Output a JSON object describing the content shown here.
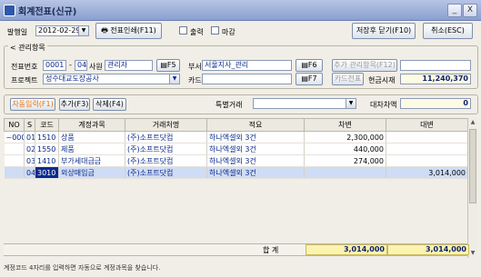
{
  "window": {
    "title": "회계전표(신규)",
    "minimize": "_",
    "close": "X"
  },
  "toolbar": {
    "date_label": "발행일",
    "date_value": "2012-02-29",
    "print_button": "전표인쇄(F11)",
    "output_label": "출력",
    "close_label": "마감",
    "save_close_button": "저장후 닫기(F10)",
    "cancel_button": "취소(ESC)"
  },
  "manage": {
    "section_title": "관리항목",
    "voucher_no_label": "전표번호",
    "voucher_no_a": "0001",
    "voucher_no_sep": "-",
    "voucher_no_b": "04",
    "employee_label": "사원",
    "employee_value": "관리자",
    "dept_label": "부서",
    "dept_value": "서울지사_관리",
    "add_item_button": "추가 관리항목(F12)",
    "project_label": "프로젝트",
    "project_value": "성수대교도장공사",
    "card_label": "카드",
    "card_value": "",
    "card_voucher_button": "카드전표",
    "cash_balance_label": "현금시재",
    "cash_balance_value": "11,240,370",
    "f5": "F5",
    "f6": "F6",
    "f7": "F7"
  },
  "actions": {
    "auto_input": "자동입력(F1)",
    "add": "추가(F3)",
    "delete": "삭제(F4)",
    "special_label": "특별거래",
    "special_value": "",
    "balance_diff_label": "대차차액",
    "balance_diff_value": "0"
  },
  "table": {
    "headers": [
      "NO",
      "S",
      "코드",
      "계정과목",
      "거래처명",
      "적요",
      "차변",
      "대변"
    ],
    "rows": [
      {
        "no": "0001",
        "s": "01",
        "code": "1510",
        "account": "상품",
        "client": "(주)소프트닷컴",
        "memo": "하나엑셀외 3건",
        "debit": "2,300,000",
        "credit": ""
      },
      {
        "no": "",
        "s": "02",
        "code": "1550",
        "account": "제품",
        "client": "(주)소프트닷컴",
        "memo": "하나엑셀외 3건",
        "debit": "440,000",
        "credit": ""
      },
      {
        "no": "",
        "s": "03",
        "code": "1410",
        "account": "부가세대급금",
        "client": "(주)소프트닷컴",
        "memo": "하나엑셀외 3건",
        "debit": "274,000",
        "credit": ""
      },
      {
        "no": "",
        "s": "04",
        "code": "3010",
        "account": "외상매입금",
        "client": "(주)소프트닷컴",
        "memo": "하나엑셀외 3건",
        "debit": "",
        "credit": "3,014,000"
      }
    ],
    "total_label": "합 계",
    "total_debit": "3,014,000",
    "total_credit": "3,014,000"
  },
  "status_text": "계정코드 4자리를 입력하면 자동으로 계정과목을 찾습니다."
}
